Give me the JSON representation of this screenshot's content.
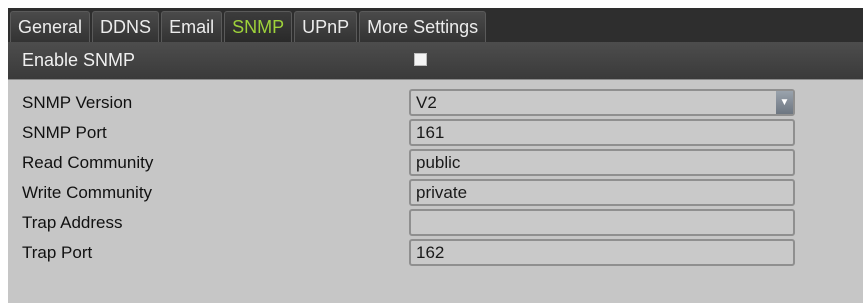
{
  "tabs": [
    {
      "label": "General"
    },
    {
      "label": "DDNS"
    },
    {
      "label": "Email"
    },
    {
      "label": "SNMP",
      "active": true
    },
    {
      "label": "UPnP"
    },
    {
      "label": "More Settings"
    }
  ],
  "enable": {
    "label": "Enable SNMP",
    "checked": false
  },
  "fields": {
    "snmp_version": {
      "label": "SNMP Version",
      "value": "V2",
      "icon": "chevron-down-icon"
    },
    "snmp_port": {
      "label": "SNMP Port",
      "value": "161"
    },
    "read_community": {
      "label": "Read Community",
      "value": "public"
    },
    "write_community": {
      "label": "Write Community",
      "value": "private"
    },
    "trap_address": {
      "label": "Trap Address",
      "value": ""
    },
    "trap_port": {
      "label": "Trap Port",
      "value": "162"
    }
  },
  "colors": {
    "active_tab": "#9ed23a",
    "tab_bar": "#2e2e2e",
    "panel": "#c6c6c6"
  }
}
